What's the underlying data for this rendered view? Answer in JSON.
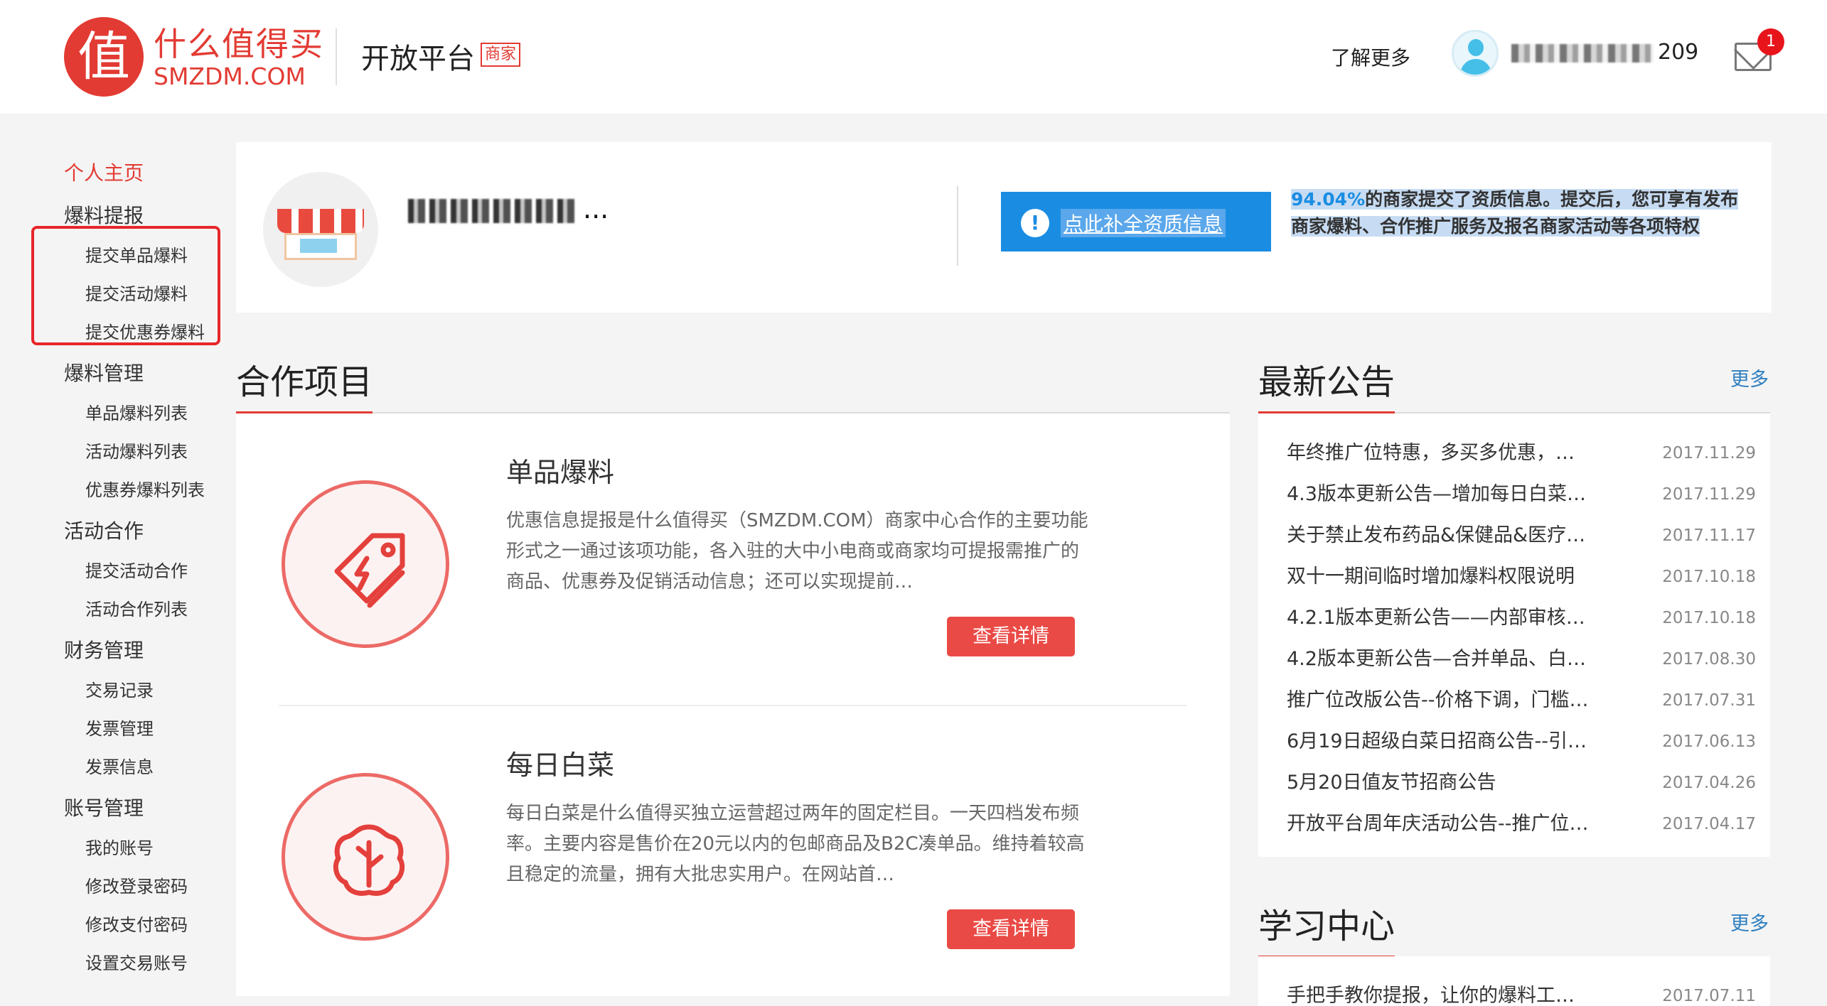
{
  "header": {
    "logo_char": "值",
    "logo_cn": "什么值得买",
    "logo_en": "SMZDM.COM",
    "platform_title": "开放平台",
    "merchant_badge": "商家",
    "learn_more": "了解更多",
    "username_suffix": "209",
    "mail_badge": "1"
  },
  "sidebar": {
    "home": "个人主页",
    "groups": [
      {
        "label": "爆料提报",
        "items": [
          "提交单品爆料",
          "提交活动爆料",
          "提交优惠券爆料"
        ]
      },
      {
        "label": "爆料管理",
        "items": [
          "单品爆料列表",
          "活动爆料列表",
          "优惠券爆料列表"
        ]
      },
      {
        "label": "活动合作",
        "items": [
          "提交活动合作",
          "活动合作列表"
        ]
      },
      {
        "label": "财务管理",
        "items": [
          "交易记录",
          "发票管理",
          "发票信息"
        ]
      },
      {
        "label": "账号管理",
        "items": [
          "我的账号",
          "修改登录密码",
          "修改支付密码",
          "设置交易账号"
        ]
      }
    ]
  },
  "profile": {
    "shop_name_suffix": "...",
    "qual_button": "点此补全资质信息",
    "qual_pct": "94.04%",
    "qual_desc_rest": "的商家提交了资质信息。提交后，您可享有发布商家爆料、合作推广服务及报名商家活动等各项特权"
  },
  "coop": {
    "title": "合作项目",
    "items": [
      {
        "title": "单品爆料",
        "desc": "优惠信息提报是什么值得买（SMZDM.COM）商家中心合作的主要功能形式之一通过该项功能，各入驻的大中小电商或商家均可提报需推广的商品、优惠券及促销活动信息；还可以实现提前…",
        "button": "查看详情",
        "icon": "tag-icon"
      },
      {
        "title": "每日白菜",
        "desc": "每日白菜是什么值得买独立运营超过两年的固定栏目。一天四档发布频率。主要内容是售价在20元以内的包邮商品及B2C凑单品。维持着较高且稳定的流量，拥有大批忠实用户。在网站首…",
        "button": "查看详情",
        "icon": "cabbage-icon"
      }
    ]
  },
  "notice": {
    "title": "最新公告",
    "more": "更多",
    "items": [
      {
        "title": "年终推广位特惠，多买多优惠，…",
        "date": "2017.11.29"
      },
      {
        "title": "4.3版本更新公告—增加每日白菜…",
        "date": "2017.11.29"
      },
      {
        "title": "关于禁止发布药品&保健品&医疗…",
        "date": "2017.11.17"
      },
      {
        "title": "双十一期间临时增加爆料权限说明",
        "date": "2017.10.18"
      },
      {
        "title": "4.2.1版本更新公告——内部审核…",
        "date": "2017.10.18"
      },
      {
        "title": "4.2版本更新公告—合并单品、白…",
        "date": "2017.08.30"
      },
      {
        "title": "推广位改版公告--价格下调，门槛…",
        "date": "2017.07.31"
      },
      {
        "title": "6月19日超级白菜日招商公告--引…",
        "date": "2017.06.13"
      },
      {
        "title": "5月20日值友节招商公告",
        "date": "2017.04.26"
      },
      {
        "title": "开放平台周年庆活动公告--推广位…",
        "date": "2017.04.17"
      }
    ]
  },
  "learn": {
    "title": "学习中心",
    "more": "更多",
    "items": [
      {
        "title": "手把手教你提报，让你的爆料工…",
        "date": "2017.07.11"
      }
    ]
  }
}
